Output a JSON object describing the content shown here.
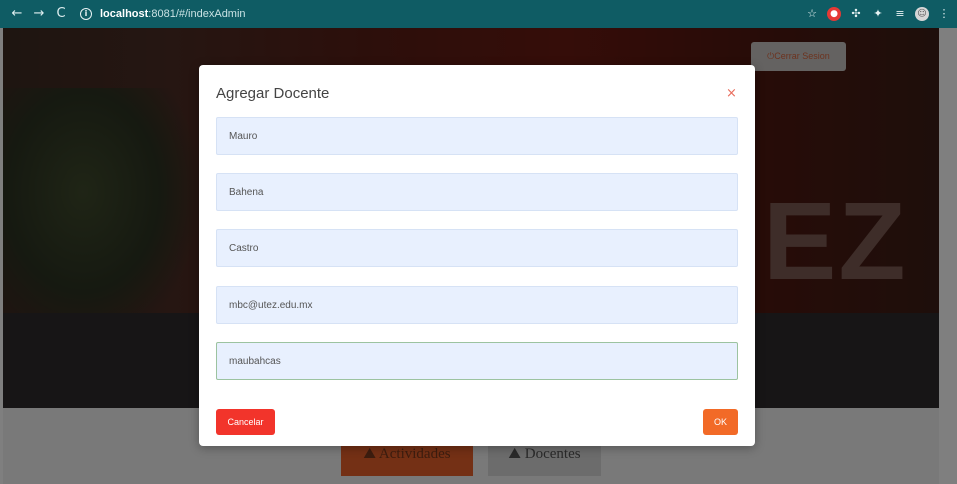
{
  "browser": {
    "url_host": "localhost",
    "url_path": ":8081/#/indexAdmin",
    "back_icon": "←",
    "forward_icon": "→",
    "reload_icon": "C",
    "info_icon": "i",
    "extensions": {
      "star_icon": "☆",
      "ext1_icon": "●",
      "ext2_icon": "✣",
      "ext3_icon": "✦",
      "ext4_icon": "≡",
      "profile_icon": "☺",
      "menu_icon": "⋮"
    }
  },
  "page": {
    "logout_label": "⏻Cerrar Sesion",
    "tab_activities_label": "⛰ Actividades",
    "tab_teachers_label": "⛰ Docentes",
    "background_text": "EZ"
  },
  "modal": {
    "title": "Agregar Docente",
    "close_icon": "×",
    "fields": [
      {
        "value": "Mauro"
      },
      {
        "value": "Bahena"
      },
      {
        "value": "Castro"
      },
      {
        "value": "mbc@utez.edu.mx"
      },
      {
        "value": "maubahcas"
      }
    ],
    "cancel_label": "Cancelar",
    "ok_label": "OK"
  },
  "colors": {
    "browser_bar": "#0f5c64",
    "cancel": "#f2342b",
    "ok": "#f26a27",
    "field_bg": "#e8f0fe"
  }
}
